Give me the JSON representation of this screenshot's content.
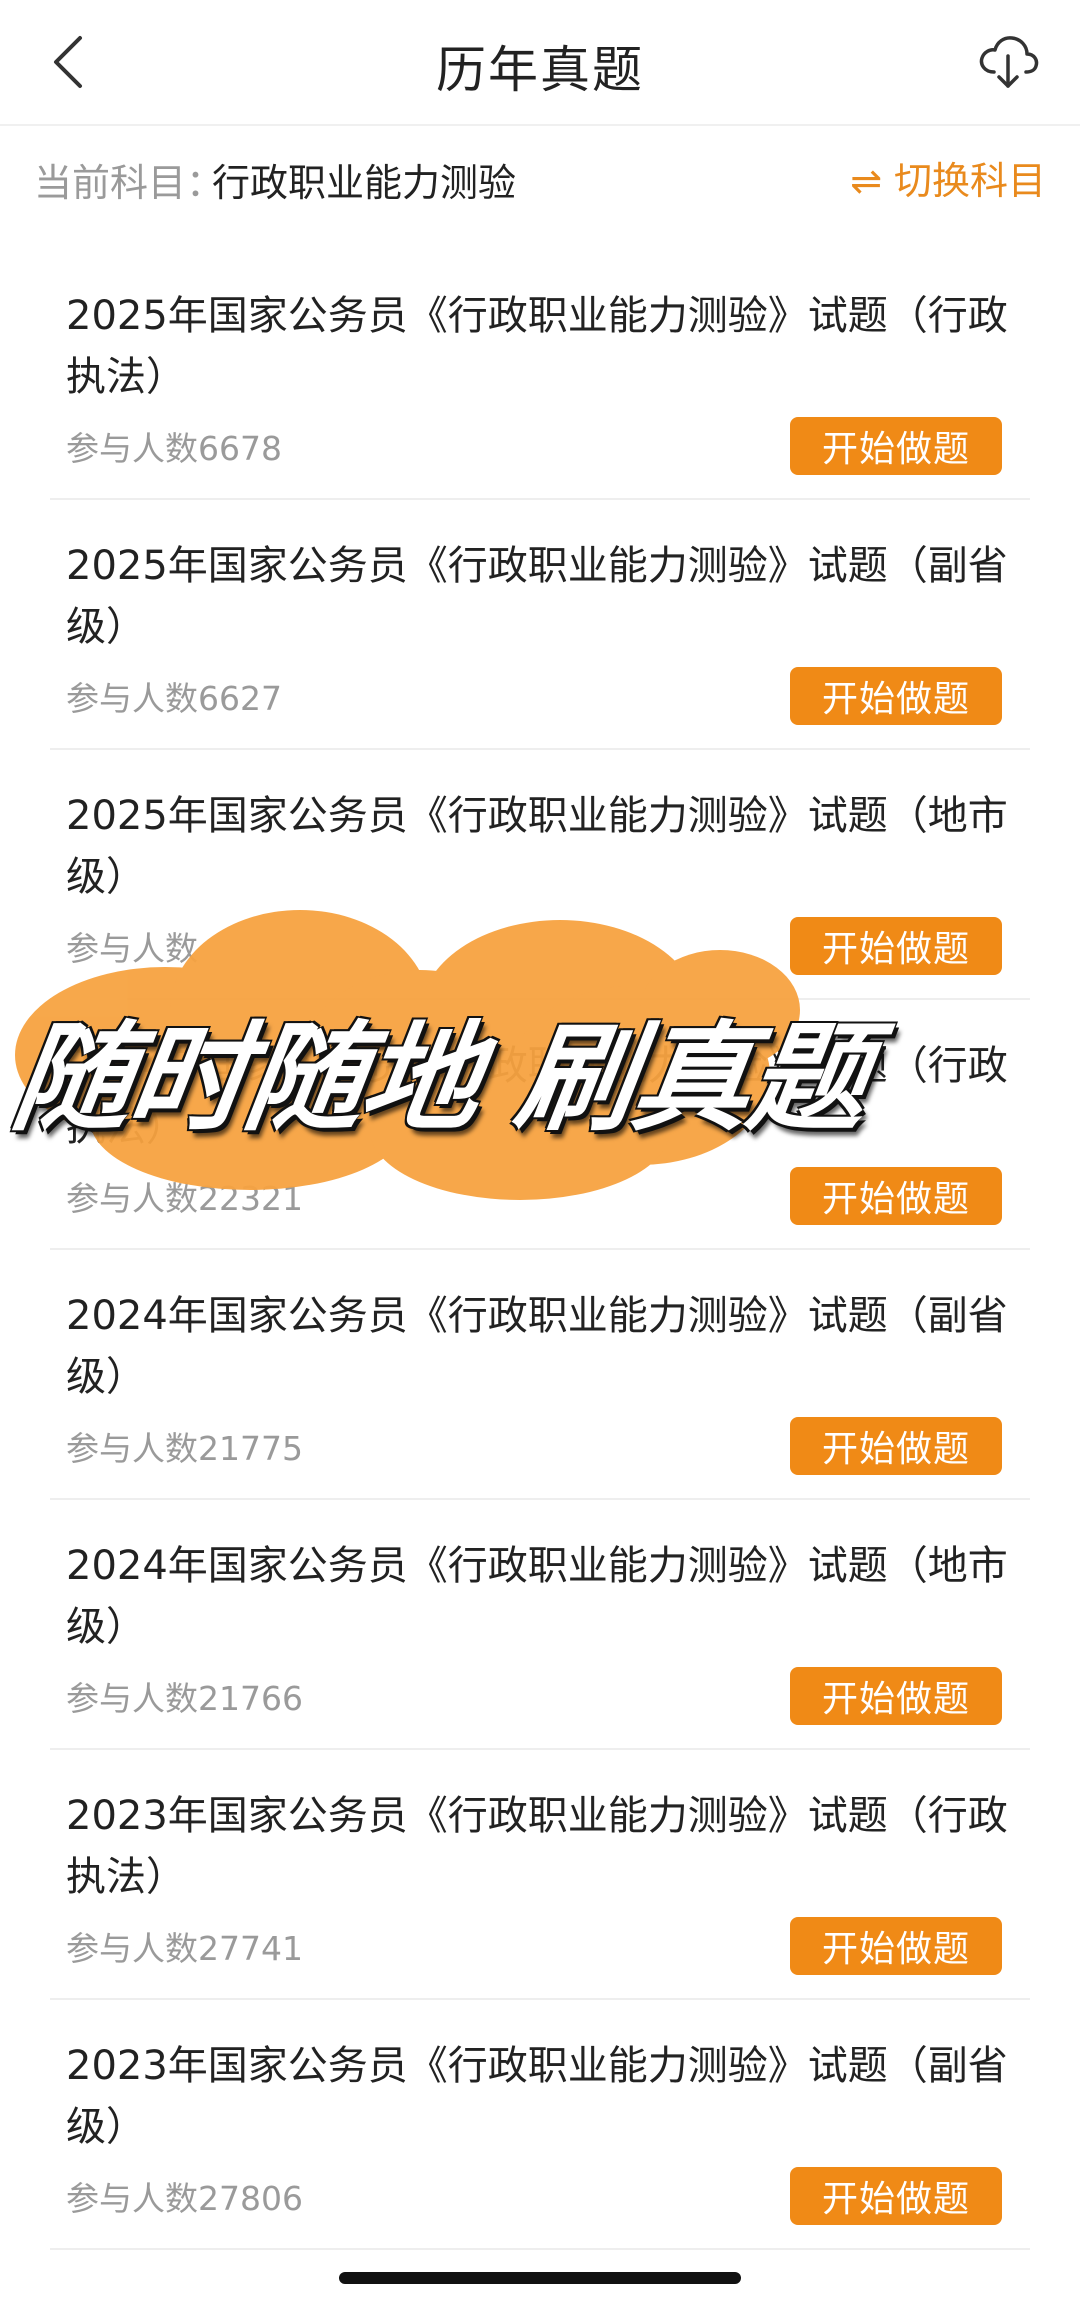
{
  "header": {
    "title": "历年真题",
    "back_icon": "chevron-left-icon",
    "download_icon": "cloud-download-icon"
  },
  "subject": {
    "label": "当前科目：",
    "value": "行政职业能力测验",
    "switch_label": "⇌ 切换科目",
    "accent_color": "#e98a1d"
  },
  "exams": [
    {
      "title": "2025年国家公务员《行政职业能力测验》试题（行政执法）",
      "count": "参与人数6678",
      "button": "开始做题"
    },
    {
      "title": "2025年国家公务员《行政职业能力测验》试题（副省级）",
      "count": "参与人数6627",
      "button": "开始做题"
    },
    {
      "title": "2025年国家公务员《行政职业能力测验》试题（地市级）",
      "count": "参与人数",
      "button": "开始做题"
    },
    {
      "title": "2024年国家公务员《行政职业能力测验》试题（行政执法）",
      "count": "参与人数22321",
      "button": "开始做题"
    },
    {
      "title": "2024年国家公务员《行政职业能力测验》试题（副省级）",
      "count": "参与人数21775",
      "button": "开始做题"
    },
    {
      "title": "2024年国家公务员《行政职业能力测验》试题（地市级）",
      "count": "参与人数21766",
      "button": "开始做题"
    },
    {
      "title": "2023年国家公务员《行政职业能力测验》试题（行政执法）",
      "count": "参与人数27741",
      "button": "开始做题"
    },
    {
      "title": "2023年国家公务员《行政职业能力测验》试题（副省级）",
      "count": "参与人数27806",
      "button": "开始做题"
    }
  ],
  "banner": {
    "text": "随时随地 刷真题",
    "brush_color": "#f7a341"
  },
  "colors": {
    "button_bg": "#f08a16",
    "text_primary": "#222222",
    "text_secondary": "#9a9a9a"
  }
}
